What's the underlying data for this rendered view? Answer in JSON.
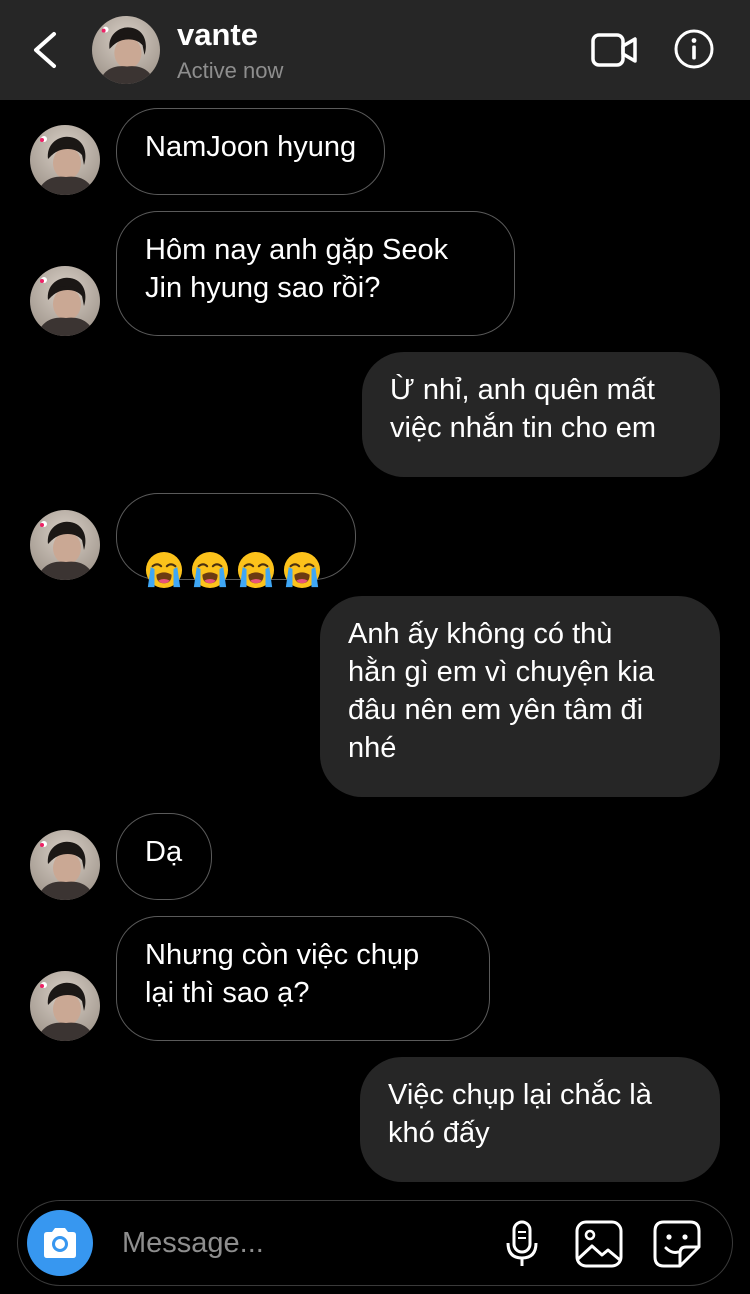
{
  "header": {
    "name": "vante",
    "status": "Active now",
    "icons": [
      "chevron-left-icon",
      "video-camera-icon",
      "info-icon"
    ]
  },
  "messages": [
    {
      "side": "in",
      "text": "NamJoon hyung"
    },
    {
      "side": "in",
      "text": "Hôm nay anh gặp Seok\nJin hyung sao rồi?"
    },
    {
      "side": "out",
      "text": "Ừ nhỉ, anh quên mất\nviệc nhắn tin cho em"
    },
    {
      "side": "in",
      "text": "😭😭😭😭",
      "emoji": "loudly-crying-face",
      "count": 4
    },
    {
      "side": "out",
      "text": "Anh ấy không có thù\nhằn gì em vì chuyện kia\nđâu nên em yên tâm đi\nnhé"
    },
    {
      "side": "in",
      "text": "Dạ"
    },
    {
      "side": "in",
      "text": "Nhưng còn việc chụp\nlại thì sao ạ?"
    },
    {
      "side": "out",
      "text": "Việc chụp lại chắc là\nkhó đấy"
    }
  ],
  "composer": {
    "placeholder": "Message...",
    "icons": [
      "camera-icon",
      "microphone-icon",
      "gallery-icon",
      "sticker-icon"
    ],
    "camera_color": "#3797f0"
  },
  "colors": {
    "background": "#000000",
    "header": "#262626",
    "outgoing_bubble": "#262626",
    "incoming_border": "#5a5a5a",
    "muted_text": "#8e8e8e"
  }
}
